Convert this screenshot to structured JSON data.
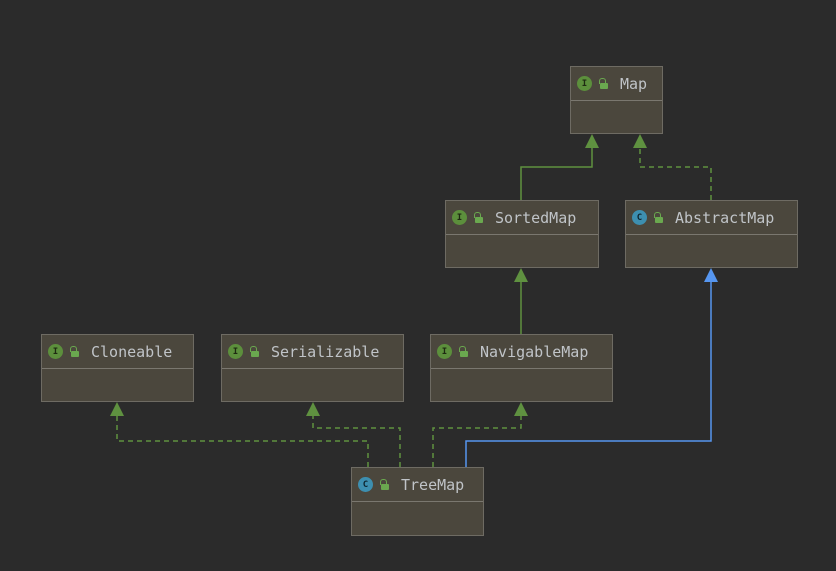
{
  "nodes": {
    "map": {
      "name": "Map",
      "kind": "interface",
      "badge": "I"
    },
    "sorted_map": {
      "name": "SortedMap",
      "kind": "interface",
      "badge": "I"
    },
    "abstract_map": {
      "name": "AbstractMap",
      "kind": "abstract-class",
      "badge": "C"
    },
    "cloneable": {
      "name": "Cloneable",
      "kind": "interface",
      "badge": "I"
    },
    "serializable": {
      "name": "Serializable",
      "kind": "interface",
      "badge": "I"
    },
    "navigable_map": {
      "name": "NavigableMap",
      "kind": "interface",
      "badge": "I"
    },
    "tree_map": {
      "name": "TreeMap",
      "kind": "class",
      "badge": "C"
    }
  },
  "edges": [
    {
      "from": "SortedMap",
      "to": "Map",
      "relation": "extends"
    },
    {
      "from": "AbstractMap",
      "to": "Map",
      "relation": "implements"
    },
    {
      "from": "NavigableMap",
      "to": "SortedMap",
      "relation": "extends"
    },
    {
      "from": "TreeMap",
      "to": "AbstractMap",
      "relation": "extends"
    },
    {
      "from": "TreeMap",
      "to": "Cloneable",
      "relation": "implements"
    },
    {
      "from": "TreeMap",
      "to": "Serializable",
      "relation": "implements"
    },
    {
      "from": "TreeMap",
      "to": "NavigableMap",
      "relation": "implements"
    }
  ],
  "colors": {
    "background": "#2b2b2b",
    "node_fill": "#4b473d",
    "interface_edge": "#5f9140",
    "class_edge": "#5696f0",
    "interface_badge": "#5c8f3c",
    "class_badge": "#3d8fb0"
  },
  "icons": {
    "interface": "interface-badge-icon",
    "class": "class-badge-icon",
    "visibility": "public-lock-icon"
  }
}
